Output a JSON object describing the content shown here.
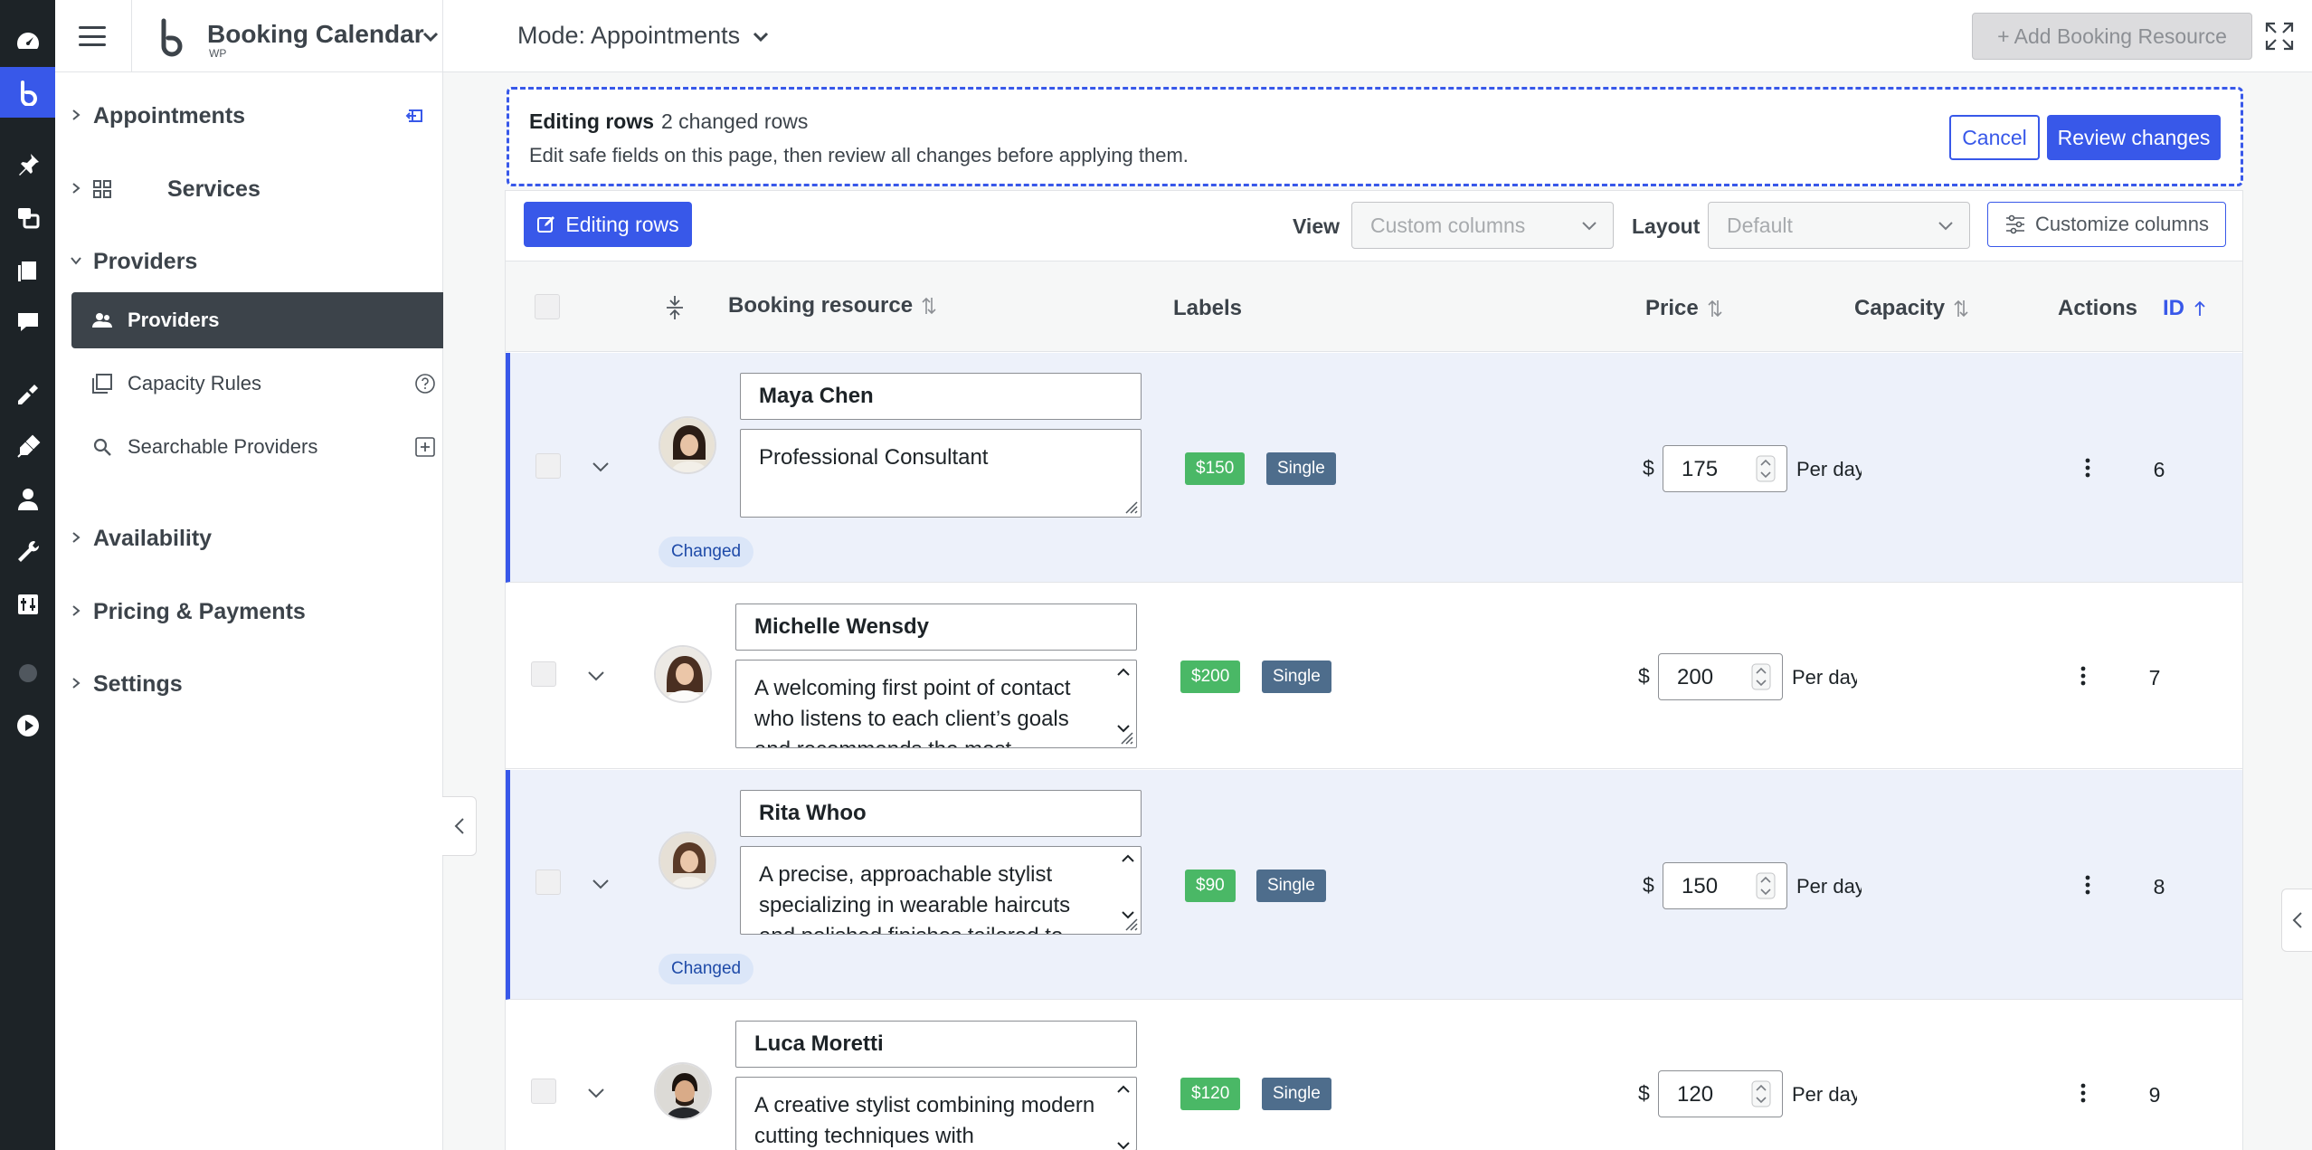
{
  "app": {
    "title": "Booking Calendar",
    "subtitle": "WP",
    "mode": "Mode: Appointments",
    "add_resource": "+ Add Booking Resource"
  },
  "sidebar": {
    "groups": [
      {
        "label": "Appointments",
        "expanded": false
      },
      {
        "label": "Services",
        "expanded": false
      },
      {
        "label": "Providers",
        "expanded": true
      },
      {
        "label": "Availability",
        "expanded": false
      },
      {
        "label": "Pricing & Payments",
        "expanded": false
      },
      {
        "label": "Settings",
        "expanded": false
      }
    ],
    "items": [
      {
        "label": "Providers",
        "active": true,
        "icon": "users-icon"
      },
      {
        "label": "Capacity Rules",
        "active": false,
        "icon": "copy-icon"
      },
      {
        "label": "Searchable Providers",
        "active": false,
        "icon": "search-icon"
      }
    ]
  },
  "banner": {
    "title": "Editing rows",
    "count": "2 changed rows",
    "hint": "Edit safe fields on this page, then review all changes before applying them.",
    "cancel": "Cancel",
    "review": "Review changes"
  },
  "toolbar": {
    "editing": "Editing rows",
    "view_label": "View",
    "view_value": "Custom columns",
    "layout_label": "Layout",
    "layout_value": "Default",
    "customize": "Customize columns"
  },
  "columns": {
    "resource": "Booking resource",
    "labels": "Labels",
    "price": "Price",
    "capacity": "Capacity",
    "actions": "Actions",
    "id": "ID"
  },
  "rows": [
    {
      "name": "Maya Chen",
      "description": "Professional Consultant",
      "price_label": "$150",
      "type": "Single",
      "currency": "$",
      "price": "175",
      "per": "Per day",
      "id": "6",
      "changed": true,
      "changed_label": "Changed"
    },
    {
      "name": "Michelle Wensdy",
      "description": "A welcoming first point of contact who listens to each client’s goals and recommends the most",
      "price_label": "$200",
      "type": "Single",
      "currency": "$",
      "price": "200",
      "per": "Per day",
      "id": "7",
      "changed": false,
      "changed_label": ""
    },
    {
      "name": "Rita Whoo",
      "description": "A precise, approachable stylist specializing in wearable haircuts and polished finishes tailored to",
      "price_label": "$90",
      "type": "Single",
      "currency": "$",
      "price": "150",
      "per": "Per day",
      "id": "8",
      "changed": true,
      "changed_label": "Changed"
    },
    {
      "name": "Luca Moretti",
      "description": "A creative stylist combining modern cutting techniques with",
      "price_label": "$120",
      "type": "Single",
      "currency": "$",
      "price": "120",
      "per": "Per day",
      "id": "9",
      "changed": false,
      "changed_label": ""
    }
  ],
  "colors": {
    "accent": "#3858e9",
    "rail": "#1d2327",
    "price_label": "#4ab866",
    "type_label": "#4e6d8c"
  }
}
